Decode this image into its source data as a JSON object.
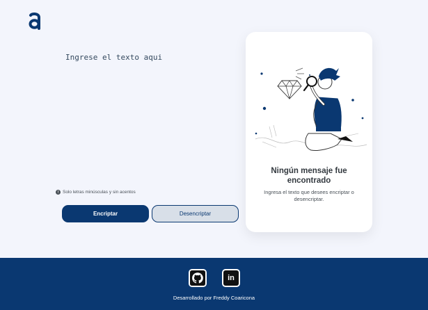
{
  "brand": {
    "logo_letter": "a",
    "logo_color": "#0a3871"
  },
  "input": {
    "placeholder": "Ingrese el texto aqui",
    "value": ""
  },
  "hint": {
    "icon": "info-icon",
    "icon_glyph": "!",
    "text": "Solo letras minúsculas y sin acentos"
  },
  "buttons": {
    "encrypt": "Encriptar",
    "decrypt": "Desencriptar"
  },
  "result_card": {
    "title": "Ningún mensaje fue encontrado",
    "subtitle": "Ingresa el texto que desees encriptar o desencriptar."
  },
  "footer": {
    "github_icon": "github-icon",
    "linkedin_icon": "linkedin-icon",
    "linkedin_text": "in",
    "credit": "Desarrollado por Freddy Coaricona"
  },
  "colors": {
    "primary": "#0a3871",
    "background": "#f3f5fc",
    "secondary_button": "#d8dfe8"
  }
}
